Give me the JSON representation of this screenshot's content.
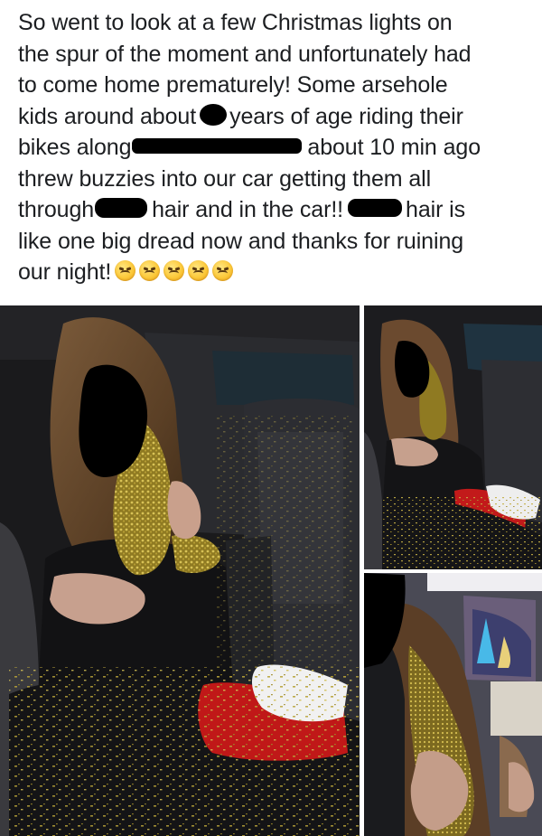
{
  "post": {
    "line1": "So went to look at a few Christmas lights on",
    "line2": "the spur of the moment and unfortunately had",
    "line3": "to come home prematurely!  Some arsehole",
    "line4a": "kids around about",
    "line4b": "years of age riding their",
    "line5a": "bikes along",
    "line5b": "about 10 min ago",
    "line6": "threw buzzies into our car getting them all",
    "line7a": "through",
    "line7b": "hair and in the car!!",
    "line7c": "hair is",
    "line8": "like one big dread now and thanks for ruining",
    "line9": "our night!",
    "emoji_name": "weary-face-emoji",
    "emoji_count": 5
  },
  "photos": {
    "photo1_desc_name": "photo-girl-in-car-main",
    "photo2_desc_name": "photo-girl-in-car-side",
    "photo3_desc_name": "photo-girl-at-home"
  },
  "colors": {
    "text": "#1c1e21",
    "redaction": "#000000",
    "burr": "#c9b036"
  }
}
